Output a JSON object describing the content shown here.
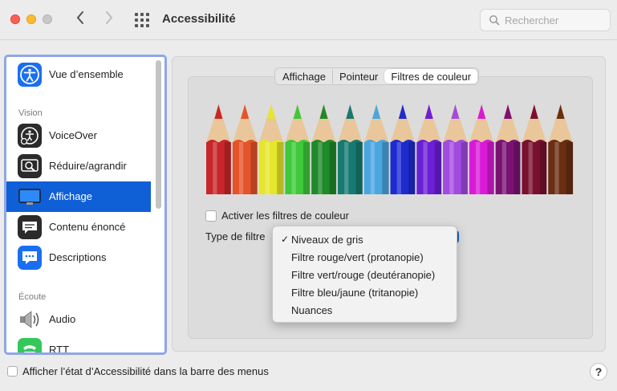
{
  "window": {
    "title": "Accessibilité"
  },
  "search": {
    "placeholder": "Rechercher"
  },
  "sidebar": {
    "top_item": {
      "label": "Vue d’ensemble",
      "icon": "accessibility-icon"
    },
    "sections": [
      {
        "label": "Vision"
      },
      {
        "label": "Écoute"
      }
    ],
    "items": [
      {
        "label": "VoiceOver",
        "icon": "voiceover-icon"
      },
      {
        "label": "Réduire/agrandir",
        "icon": "zoom-icon"
      },
      {
        "label": "Affichage",
        "icon": "display-icon",
        "selected": true
      },
      {
        "label": "Contenu énoncé",
        "icon": "spoken-content-icon"
      },
      {
        "label": "Descriptions",
        "icon": "descriptions-icon"
      },
      {
        "label": "Audio",
        "icon": "speaker-icon"
      },
      {
        "label": "RTT",
        "icon": "rtt-icon"
      }
    ]
  },
  "tabs": [
    {
      "label": "Affichage"
    },
    {
      "label": "Pointeur"
    },
    {
      "label": "Filtres de couleur",
      "active": true
    }
  ],
  "color_filters": {
    "enable_label": "Activer les filtres de couleur",
    "enabled": false,
    "filter_type_label": "Type de filtre",
    "pencil_colors": [
      "#c8262a",
      "#e5532a",
      "#e6e62c",
      "#3ec83a",
      "#1e8a28",
      "#177a72",
      "#4aa6df",
      "#1d2bd0",
      "#6b1fd6",
      "#a24be0",
      "#d81ad8",
      "#7b1273",
      "#7a1030",
      "#6a2e12"
    ]
  },
  "dropdown": {
    "selected_index": 0,
    "check_glyph": "✓",
    "options": [
      "Niveaux de gris",
      "Filtre rouge/vert (protanopie)",
      "Filtre vert/rouge (deutéranopie)",
      "Filtre bleu/jaune (tritanopie)",
      "Nuances"
    ]
  },
  "footer": {
    "menu_bar_label": "Afficher l’état d’Accessibilité dans la barre des menus",
    "help_label": "?"
  }
}
